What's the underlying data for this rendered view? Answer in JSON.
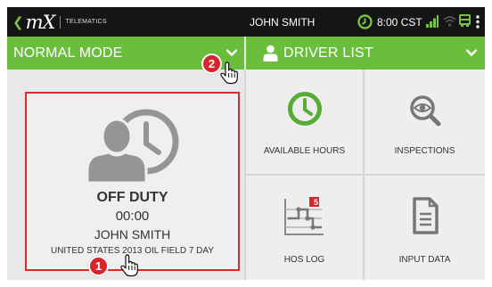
{
  "status_bar": {
    "logo_text": "mX",
    "logo_subtitle": "TELEMATICS",
    "user_name": "JOHN SMITH",
    "time": "8:00 CST",
    "icons": [
      "clock-icon",
      "signal-icon",
      "wifi-icon",
      "truck-icon",
      "overflow-menu-icon"
    ]
  },
  "mode_bar": {
    "title": "NORMAL MODE",
    "badge": "2"
  },
  "driver_list_bar": {
    "title": "DRIVER LIST"
  },
  "duty_status": {
    "status": "OFF DUTY",
    "time": "00:00",
    "driver_name": "JOHN SMITH",
    "ruleset": "UNITED STATES 2013 OIL FIELD 7 DAY",
    "badge": "1"
  },
  "tiles": [
    {
      "label": "AVAILABLE HOURS",
      "icon": "clock-icon"
    },
    {
      "label": "INSPECTIONS",
      "icon": "eye-magnifier-icon"
    },
    {
      "label": "HOS LOG",
      "icon": "log-chart-icon",
      "count": "5"
    },
    {
      "label": "INPUT DATA",
      "icon": "document-icon"
    }
  ],
  "colors": {
    "header_green": "#6bbd3c",
    "status_bar": "#151515",
    "highlight_red": "#d92b2b",
    "badge_red": "#d7262b",
    "icon_green": "#55ad36",
    "icon_gray": "#777777"
  }
}
